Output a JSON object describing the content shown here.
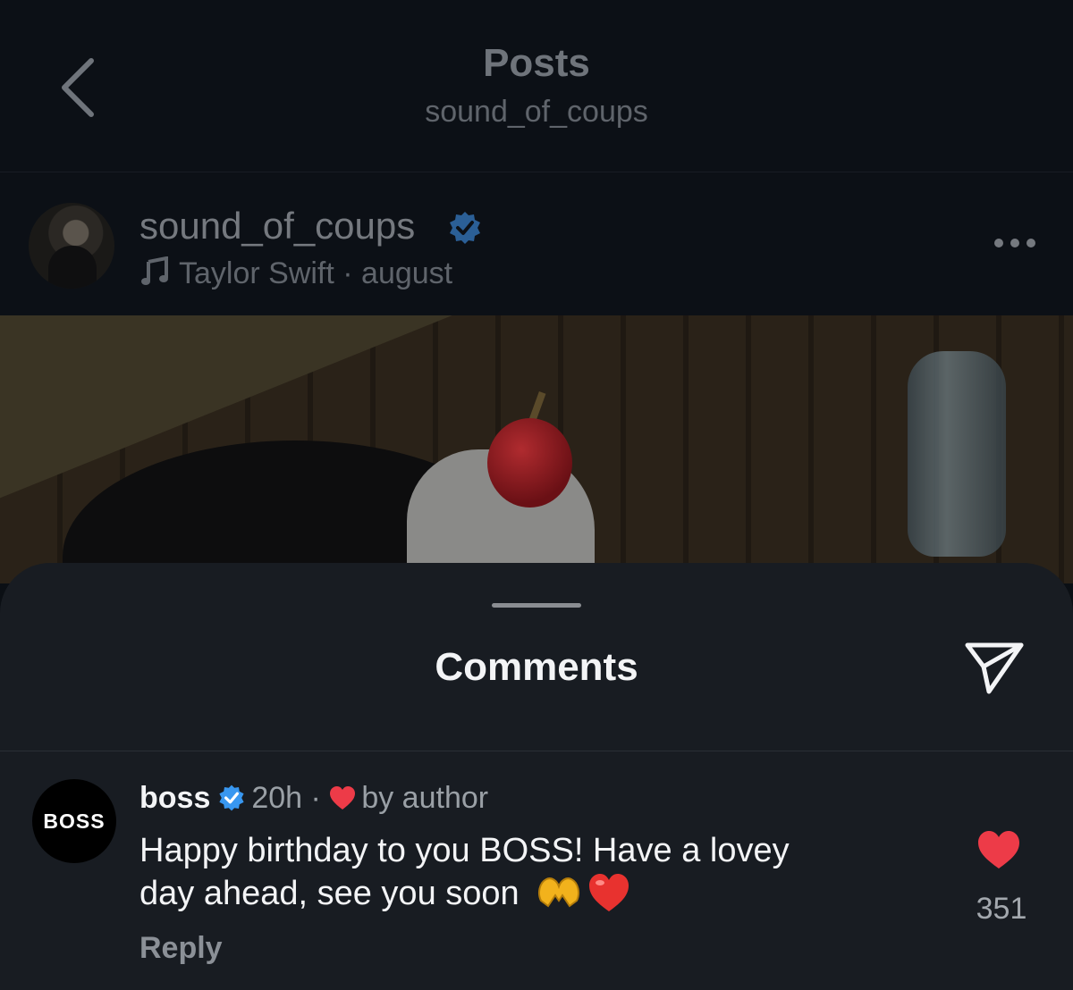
{
  "nav": {
    "title": "Posts",
    "subtitle": "sound_of_coups"
  },
  "post": {
    "username": "sound_of_coups",
    "music": "Taylor Swift · august"
  },
  "comments_sheet": {
    "title": "Comments",
    "comment": {
      "avatar_text": "BOSS",
      "username": "boss",
      "time": "20h",
      "separator": "·",
      "liked_by": "by author",
      "text_line1": "Happy birthday to you BOSS! Have a lovey",
      "text_line2": "day ahead, see you soon",
      "reply_label": "Reply",
      "like_count": "351"
    }
  },
  "colors": {
    "verified": "#3897f0",
    "like": "#ed3b48",
    "sheet_bg": "#181c22"
  }
}
